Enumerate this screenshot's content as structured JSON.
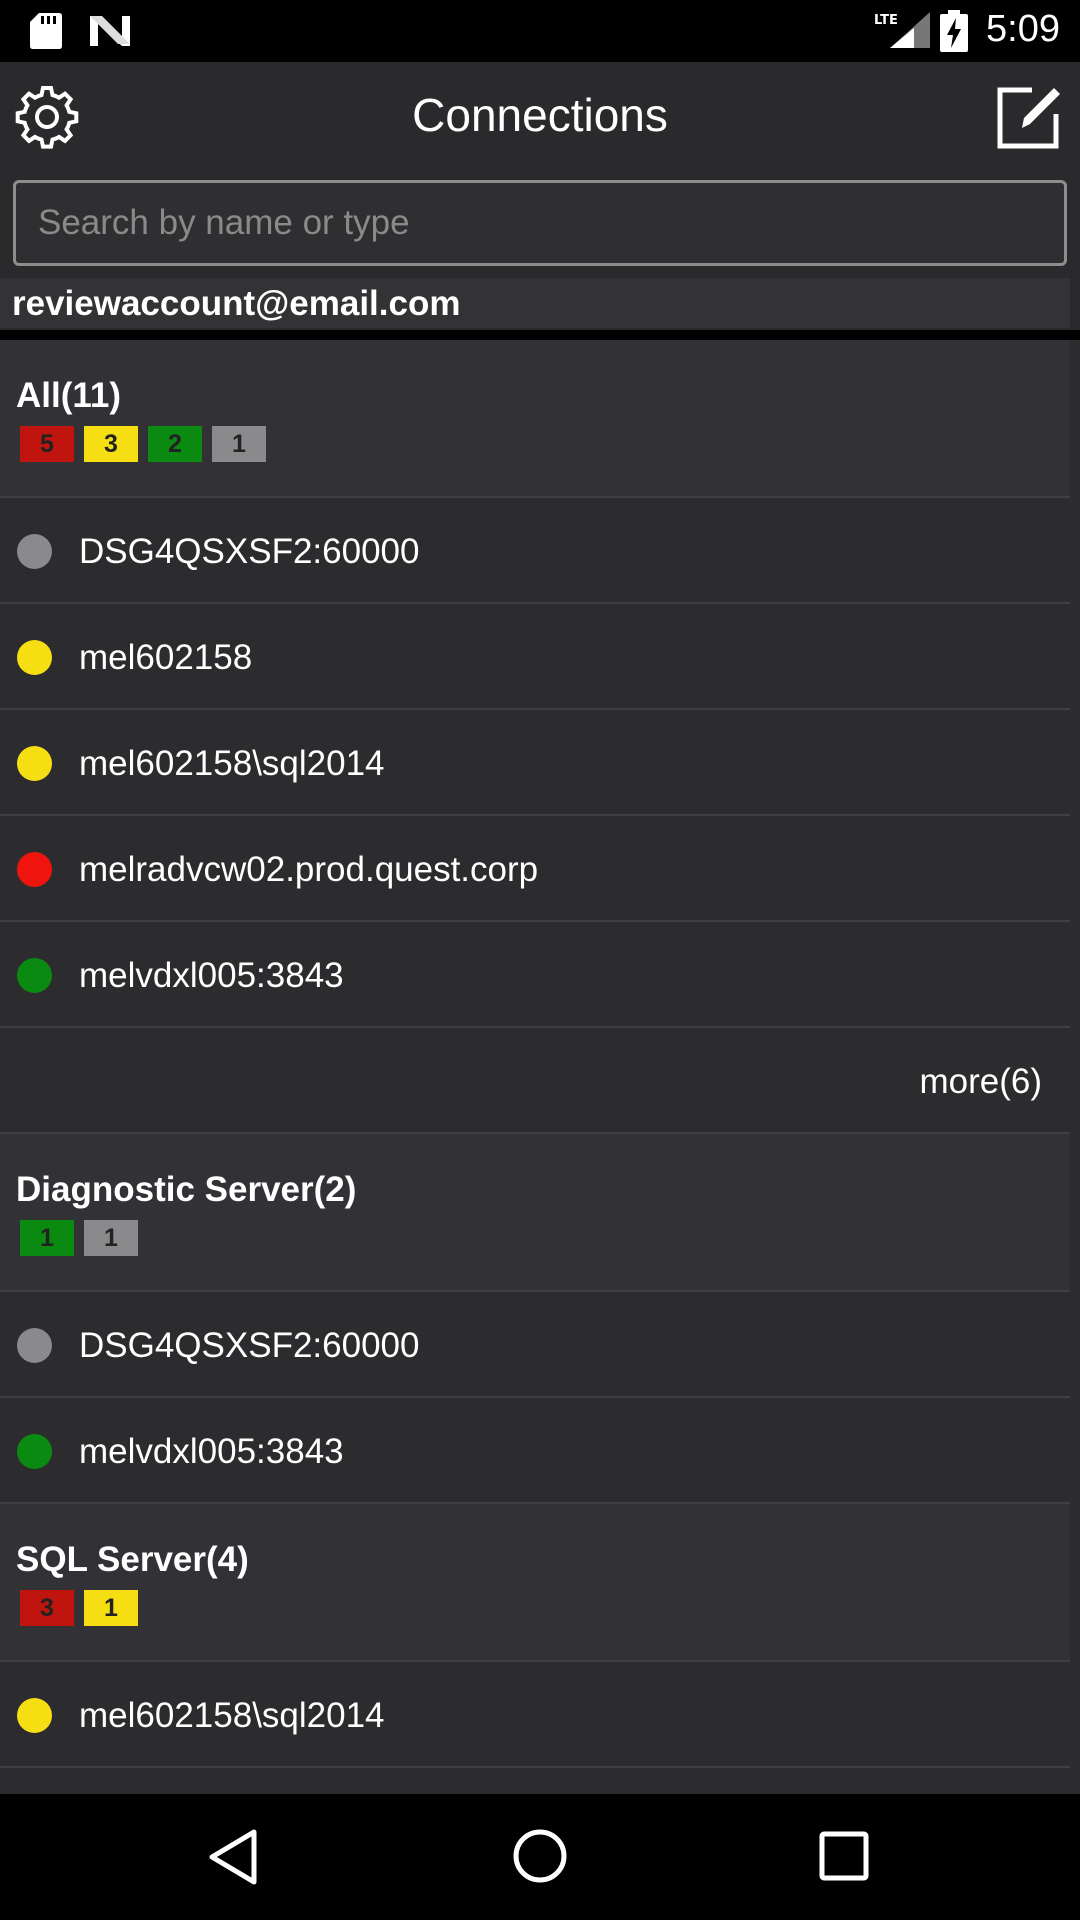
{
  "status_bar": {
    "time": "5:09",
    "network_label": "LTE",
    "icons": [
      "sd-card-icon",
      "n-notification-icon",
      "lte-signal-icon",
      "battery-charging-icon"
    ]
  },
  "header": {
    "title": "Connections",
    "left_icon": "gear-icon",
    "right_icon": "compose-icon"
  },
  "search": {
    "placeholder": "Search by name or type",
    "value": ""
  },
  "account": {
    "email": "reviewaccount@email.com"
  },
  "colors": {
    "red": "#c0140e",
    "yellow": "#f5df12",
    "green": "#0b8a12",
    "gray": "#8a8a8c",
    "dot_red": "#f0140e",
    "dot_yellow": "#f5df12",
    "dot_green": "#0b8a12",
    "dot_gray": "#8a8a8c"
  },
  "groups": [
    {
      "title": "All(11)",
      "badges": [
        {
          "count": "5",
          "status": "red"
        },
        {
          "count": "3",
          "status": "yellow"
        },
        {
          "count": "2",
          "status": "green"
        },
        {
          "count": "1",
          "status": "gray"
        }
      ],
      "items": [
        {
          "label": "DSG4QSXSF2:60000",
          "status": "gray"
        },
        {
          "label": "mel602158",
          "status": "yellow"
        },
        {
          "label": "mel602158\\sql2014",
          "status": "yellow"
        },
        {
          "label": "melradvcw02.prod.quest.corp",
          "status": "red"
        },
        {
          "label": "melvdxl005:3843",
          "status": "green"
        }
      ],
      "more": "more(6)"
    },
    {
      "title": "Diagnostic Server(2)",
      "badges": [
        {
          "count": "1",
          "status": "green"
        },
        {
          "count": "1",
          "status": "gray"
        }
      ],
      "items": [
        {
          "label": "DSG4QSXSF2:60000",
          "status": "gray"
        },
        {
          "label": "melvdxl005:3843",
          "status": "green"
        }
      ]
    },
    {
      "title": "SQL Server(4)",
      "badges": [
        {
          "count": "3",
          "status": "red"
        },
        {
          "count": "1",
          "status": "yellow"
        }
      ],
      "items": [
        {
          "label": "mel602158\\sql2014",
          "status": "yellow"
        }
      ]
    }
  ],
  "nav": {
    "icons": [
      "back-icon",
      "home-icon",
      "recents-icon"
    ]
  }
}
